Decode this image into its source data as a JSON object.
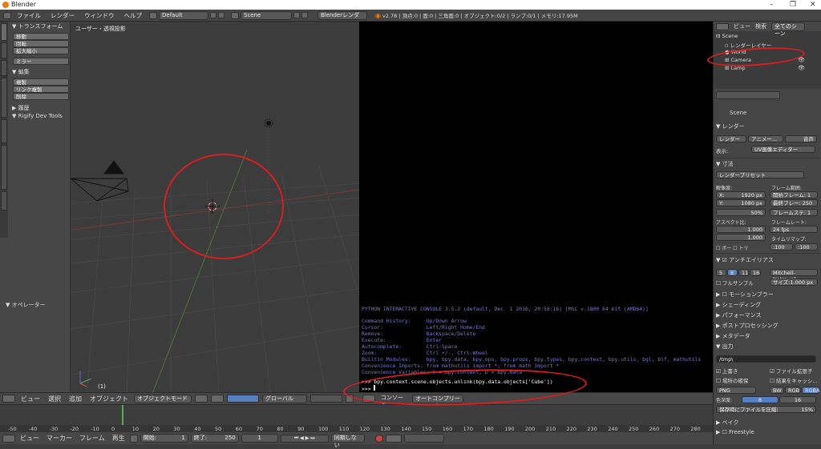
{
  "window": {
    "title": "Blender"
  },
  "menu": {
    "items": [
      "ファイル",
      "レンダー",
      "ウィンドウ",
      "ヘルプ"
    ],
    "layout": "Default",
    "scene": "Scene",
    "engine": "Blenderレンダー",
    "stats": "v2.78 | 頂点:0 | 面:0 | 三角面:0 | オブジェクト:0/2 | ランプ:0/1 | メモリ:17.95M"
  },
  "toolshelf": {
    "transform_header": "トランスフォーム",
    "transform_items": [
      "移動",
      "回転",
      "拡大縮小"
    ],
    "mirror": "ミラー",
    "edit_header": "編集",
    "edit_items": [
      "複製",
      "リンク複製",
      "削除"
    ],
    "history": "履歴",
    "rigify": "Rigify Dev Tools",
    "operator": "オペレーター",
    "tabs": [
      "ツール",
      "作成",
      "関係",
      "アニメーション",
      "物理演算",
      "グリースペンシル",
      "Tools"
    ]
  },
  "viewport": {
    "label": "ユーザー・透視投影",
    "frame": "(1)"
  },
  "console": {
    "banner": "PYTHON INTERACTIVE CONSOLE 3.5.2 (default, Dec  1 2016, 20:58:16) [MSC v.1800 64 bit (AMD64)]",
    "help": [
      "Command History:     Up/Down Arrow",
      "Cursor:              Left/Right Home/End",
      "Remove:              Backspace/Delete",
      "Execute:             Enter",
      "Autocomplete:        Ctrl-Space",
      "Zoom:                Ctrl +/-, Ctrl-Wheel",
      "Builtin Modules:     bpy, bpy.data, bpy.ops, bpy.props, bpy.types, bpy.context, bpy.utils, bgl, blf, mathutils",
      "Convenience Imports: from mathutils import *; from math import *",
      "Convenience Variables: C = bpy.context, D = bpy.data"
    ],
    "command": ">>> bpy.context.scene.objects.unlink(bpy.data.objects['Cube'])",
    "prompt": ">>> "
  },
  "header3d": {
    "items": [
      "ビュー",
      "選択",
      "追加",
      "オブジェクト"
    ],
    "mode": "オブジェクトモード",
    "orientation": "グローバル"
  },
  "headercon": {
    "console": "コンソール",
    "autocomplete": "オートコンプリート"
  },
  "timeline": {
    "ticks": [
      "-50",
      "-40",
      "-30",
      "-20",
      "-10",
      "0",
      "10",
      "20",
      "30",
      "40",
      "50",
      "60",
      "70",
      "80",
      "90",
      "100",
      "110",
      "120",
      "130",
      "140",
      "150",
      "160",
      "170",
      "180",
      "190",
      "200",
      "210",
      "220",
      "230",
      "240",
      "250",
      "260",
      "270",
      "280"
    ],
    "footer": [
      "ビュー",
      "マーカー",
      "フレーム",
      "再生"
    ],
    "start_label": "開始:",
    "start": "1",
    "end_label": "終了:",
    "end": "250",
    "current": "1",
    "sync": "同期しない"
  },
  "outliner": {
    "header": [
      "ビュー",
      "検索"
    ],
    "filter": "全てのシーン",
    "items": [
      "Scene",
      "レンダーレイヤー",
      "World",
      "Camera",
      "Lamp"
    ]
  },
  "props": {
    "scene": "Scene",
    "render": "レンダー",
    "render_btns": [
      "レンダー",
      "アニメー...",
      "音声"
    ],
    "display_label": "表示:",
    "display": "UV画像エディター",
    "dimensions": "寸法",
    "preset": "レンダープリセット",
    "resolution": "解像度:",
    "res_x": "X:",
    "res_x_val": "1920 px",
    "res_y": "Y:",
    "res_y_val": "1080 px",
    "res_pct": "50%",
    "frame_range": "フレーム範囲:",
    "frame_start": "開始フレーム: 1",
    "frame_end": "最終フレー: 250",
    "frame_step": "フレームステ: 1",
    "aspect": "アスペクト比:",
    "asp_x": "1.000",
    "asp_y": "1.000",
    "framerate_label": "フレームレート:",
    "fps": "24 fps",
    "time_remap": "タイムリマップ:",
    "remap_old": ":100",
    "remap_new": ":100",
    "border": "ボー",
    "crop": "トリ",
    "aa": "アンチエイリアス",
    "aa_samples": [
      "5",
      "8",
      "11",
      "16"
    ],
    "aa_filter": "Mitchell-Netravali",
    "full_sample": "フルサンプル",
    "size": "サイズ:1.000 px",
    "panels": [
      "モーションブラー",
      "シェーディング",
      "パフォーマンス",
      "ポストプロセッシング",
      "メタデータ"
    ],
    "output": "出力",
    "path": "/tmp\\",
    "overwrite": "上書き",
    "extensions": "ファイル拡張子",
    "placeholders": "場所の確保",
    "cache": "結果をキャッシ...",
    "format": "PNG",
    "bw": "BW",
    "rgb": "RGB",
    "rgba": "RGBA",
    "depth_label": "色深度:",
    "depth8": "8",
    "depth16": "16",
    "compress": "保存時にファイルを圧縮:",
    "compress_val": "15%",
    "bake": "ベイク",
    "freestyle": "Freestyle"
  },
  "colors": {
    "accent": "#5680c2",
    "annotation": "#d81e1e",
    "console_text": "#7a7acc"
  }
}
